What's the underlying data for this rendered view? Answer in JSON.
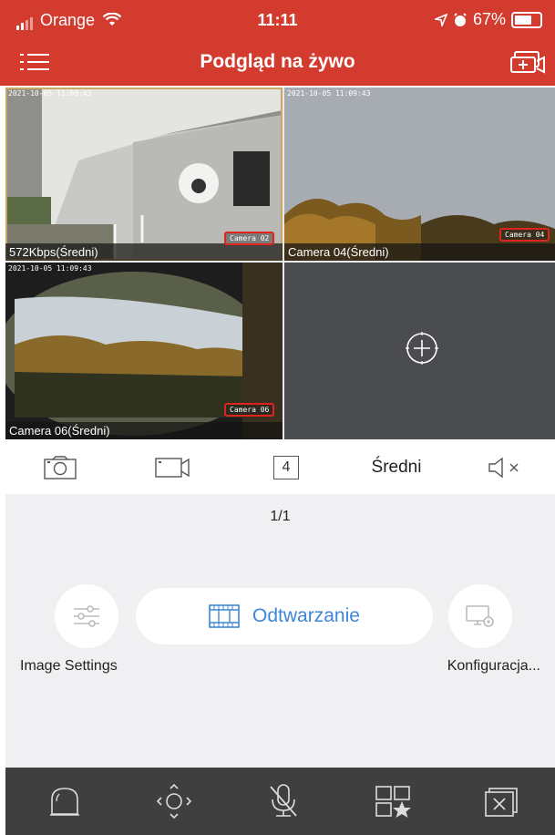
{
  "status_bar": {
    "carrier": "Orange",
    "time": "11:11",
    "battery": "67%"
  },
  "nav": {
    "title": "Podgląd na żywo",
    "menu_icon": "menu-icon",
    "add_screen_icon": "add-screen-icon"
  },
  "cameras": [
    {
      "timestamp": "2021-10-05 11:09:43",
      "label": "572Kbps(Średni)",
      "tag": "Camera 02",
      "selected": true
    },
    {
      "timestamp": "2021-10-05 11:09:43",
      "label": "Camera 04(Średni)",
      "tag": "Camera 04",
      "selected": false
    },
    {
      "timestamp": "2021-10-05 11:09:43",
      "label": "Camera 06(Średni)",
      "tag": "Camera 06",
      "selected": false
    },
    {
      "empty": true,
      "icon": "add-camera-icon"
    }
  ],
  "toolbar": {
    "snapshot_icon": "camera-icon",
    "record_icon": "video-record-icon",
    "split_count": "4",
    "quality": "Średni",
    "mute_icon": "speaker-muted-icon"
  },
  "panel": {
    "page_indicator": "1/1",
    "image_settings_label": "Image Settings",
    "playback_label": "Odtwarzanie",
    "config_label": "Konfiguracja..."
  },
  "bottom_bar": {
    "icons": [
      "alarm-light-icon",
      "ptz-icon",
      "microphone-off-icon",
      "favorites-icon",
      "close-all-icon"
    ]
  },
  "colors": {
    "accent": "#d33b2e",
    "link_blue": "#3d86d6",
    "tag_border": "#e0231e"
  }
}
